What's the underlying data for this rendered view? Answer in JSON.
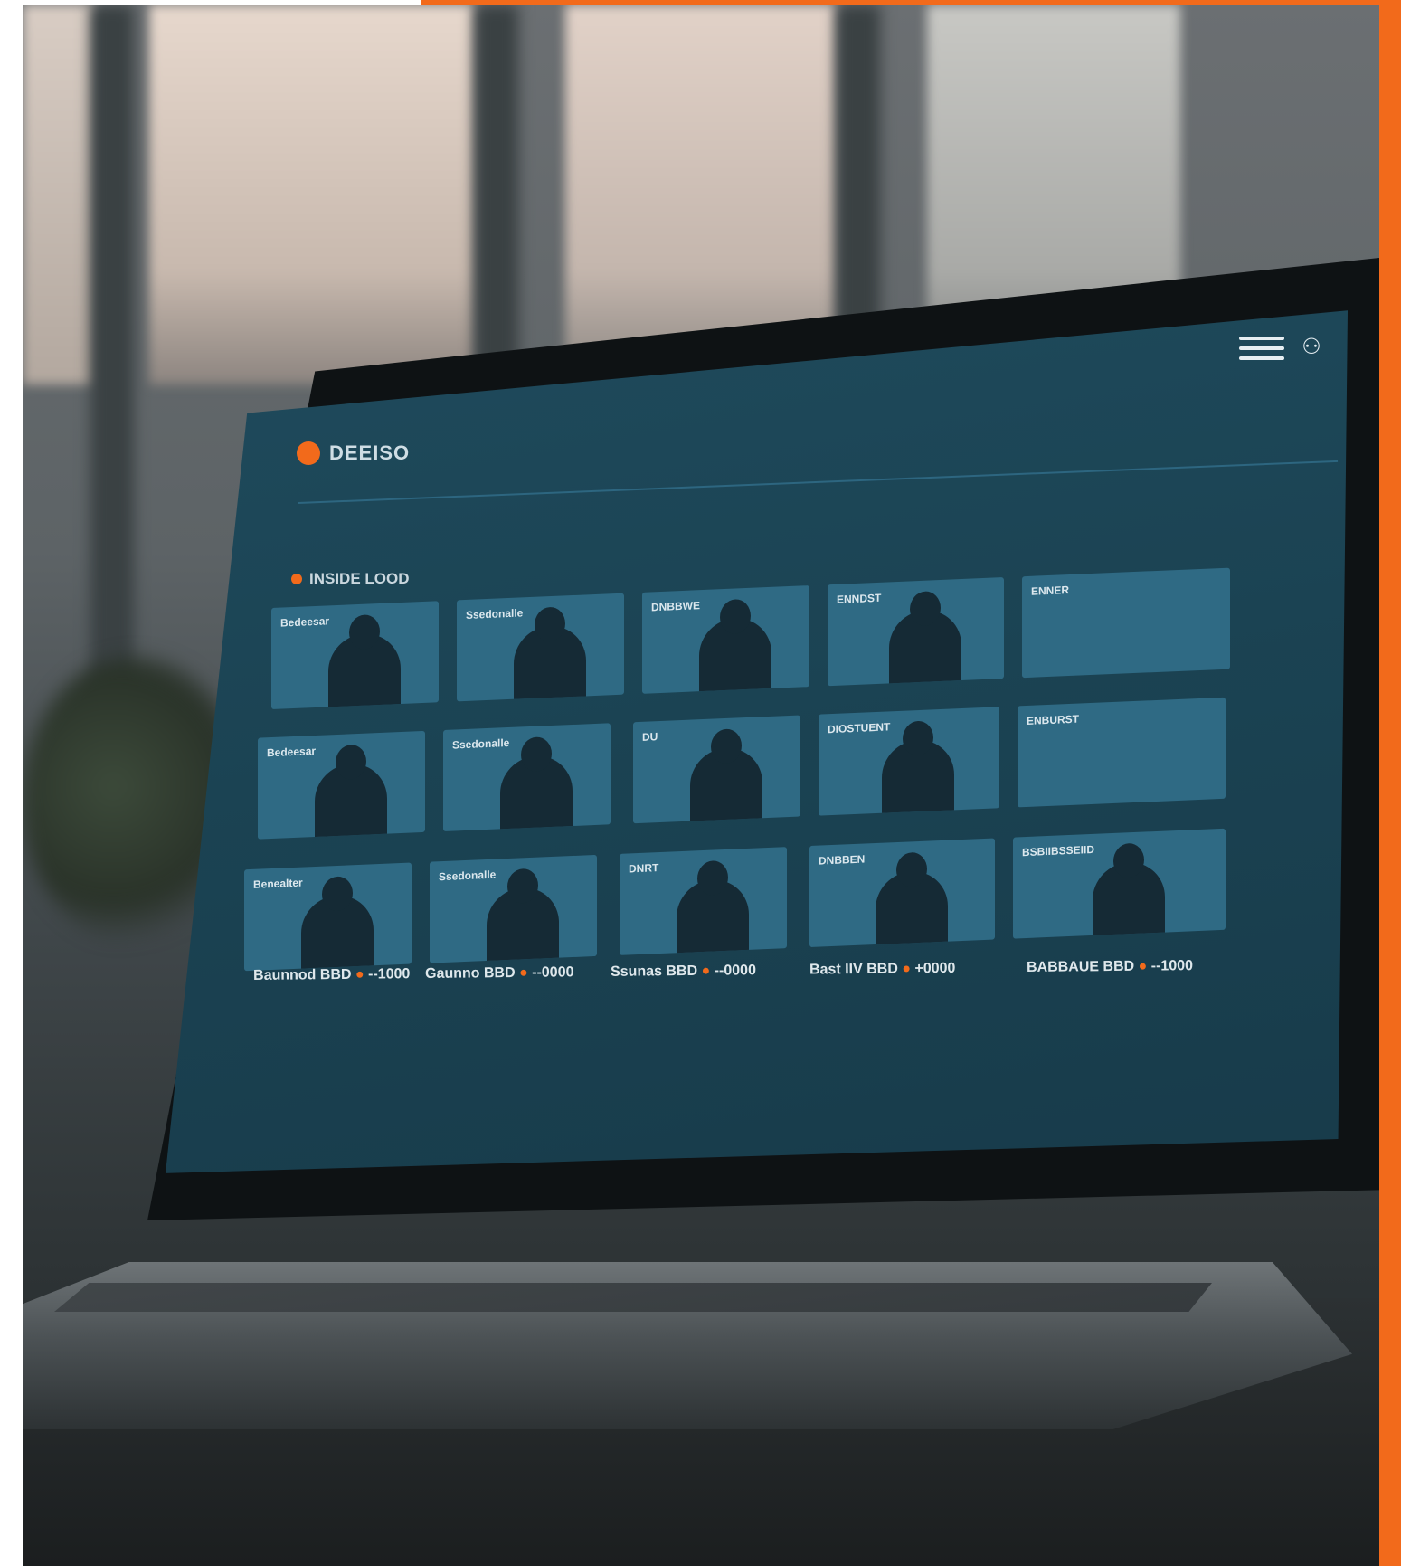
{
  "app": {
    "logo_text": "DEEISO",
    "section_title": "INSIDE LOOD"
  },
  "cards": [
    {
      "label": "Bedeesar"
    },
    {
      "label": "Ssedonalle"
    },
    {
      "label": "DNBBWE"
    },
    {
      "label": "ENNDST"
    },
    {
      "label": "ENNER"
    },
    {
      "label": "Bedeesar"
    },
    {
      "label": "Ssedonalle"
    },
    {
      "label": "DU"
    },
    {
      "label": "DIOSTUENT"
    },
    {
      "label": "ENBURST"
    },
    {
      "label": "Benealter"
    },
    {
      "label": "Ssedonalle"
    },
    {
      "label": "DNRT"
    },
    {
      "label": "DNBBEN"
    },
    {
      "label": "BSBIIBSSEIID"
    }
  ],
  "footer": [
    {
      "text": "Baunnod BBD",
      "count": "--1000"
    },
    {
      "text": "Gaunno BBD",
      "count": "--0000"
    },
    {
      "text": "Ssunas BBD",
      "count": "--0000"
    },
    {
      "text": "Bast IIV BBD",
      "count": "+0000"
    },
    {
      "text": "BABBAUE BBD",
      "count": "--1000"
    }
  ],
  "colors": {
    "accent": "#f26a1b",
    "screen": "#1b4353",
    "card": "#2f6a84"
  },
  "icons": {
    "menu": "hamburger-icon",
    "user": "user-icon"
  }
}
